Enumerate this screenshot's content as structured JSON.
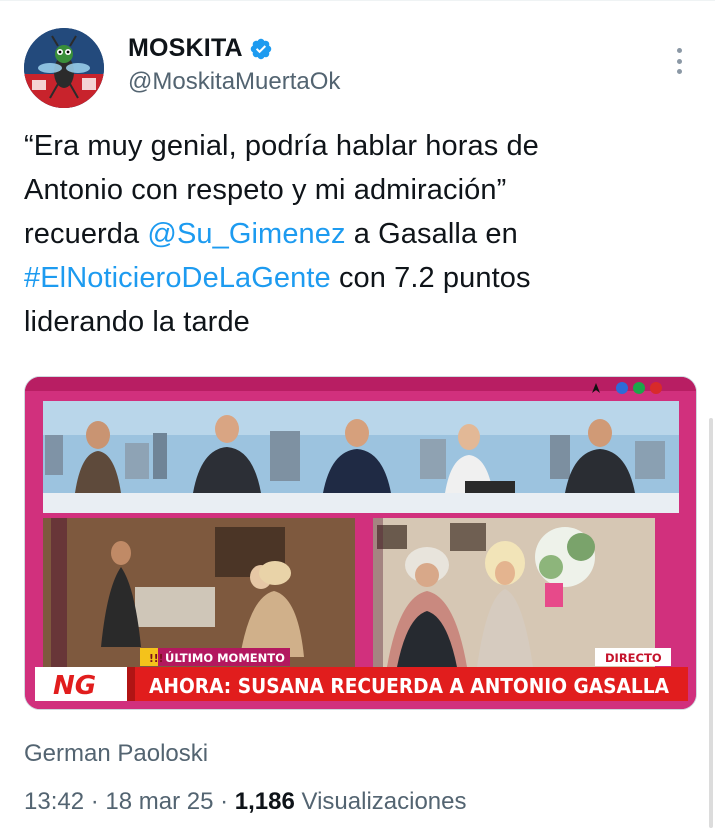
{
  "user": {
    "display_name": "MOSKITA",
    "handle": "@MoskitaMuertaOk",
    "verified": true,
    "avatar_icon": "mosquito-avatar",
    "accent_color": "#1d9bf0"
  },
  "tweet": {
    "line1": "“Era muy genial, podría hablar horas de",
    "line2": "Antonio con respeto y mi admiración”",
    "line3_pre": "recuerda ",
    "mention": "@Su_Gimenez",
    "line3_post": " a Gasalla en",
    "hashtag": "#ElNoticieroDeLaGente",
    "line4_post": " con 7.2 puntos",
    "line5": "liderando la tarde"
  },
  "media": {
    "breaking_label": "ÚLTIMO MOMENTO",
    "breaking_mark": "!!!",
    "live_label": "DIRECTO",
    "channel_logo": "NG",
    "headline": "AHORA: SUSANA RECUERDA A ANTONIO GASALLA"
  },
  "note_author": "German Paoloski",
  "meta": {
    "time": "13:42",
    "separator": " · ",
    "date": "18 mar 25",
    "views_count": "1,186",
    "views_label": " Visualizaciones"
  },
  "menu_icon": "more-options-icon"
}
